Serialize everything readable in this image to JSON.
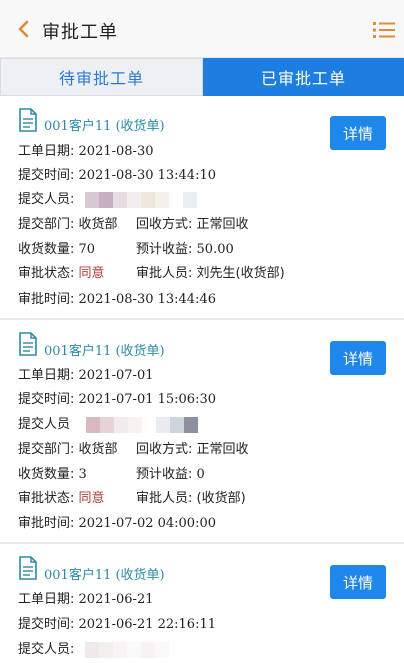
{
  "header": {
    "title": "审批工单",
    "colors": {
      "accent": "#e08a3c",
      "brand": "#1e7de0"
    }
  },
  "tabs": [
    {
      "label": "待审批工单",
      "active": false
    },
    {
      "label": "已审批工单",
      "active": true
    }
  ],
  "cards": [
    {
      "name": "001客户11 (收货单)",
      "detail_label": "详情",
      "date_label": "工单日期:",
      "date": "2021-08-30",
      "submit_time_label": "提交时间:",
      "submit_time": "2021-08-30 13:44:10",
      "submitter_label": "提交人员:",
      "dept_label": "提交部门:",
      "dept": "收货部",
      "method_label": "回收方式:",
      "method": "正常回收",
      "qty_label": "收货数量:",
      "qty": "70",
      "income_label": "预计收益:",
      "income": "50.00",
      "status_label": "审批状态:",
      "status": "同意",
      "approver_label": "审批人员:",
      "approver": "刘先生(收货部)",
      "approve_time_label": "审批时间:",
      "approve_time": "2021-08-30 13:44:46"
    },
    {
      "name": "001客户11 (收货单)",
      "detail_label": "详情",
      "date_label": "工单日期:",
      "date": "2021-07-01",
      "submit_time_label": "提交时间:",
      "submit_time": "2021-07-01 15:06:30",
      "submitter_label": "提交人员",
      "dept_label": "提交部门:",
      "dept": "收货部",
      "method_label": "回收方式:",
      "method": "正常回收",
      "qty_label": "收货数量:",
      "qty": "3",
      "income_label": "预计收益:",
      "income": "0",
      "status_label": "审批状态:",
      "status": "同意",
      "approver_label": "审批人员:",
      "approver": "(收货部)",
      "approve_time_label": "审批时间:",
      "approve_time": "2021-07-02 04:00:00"
    },
    {
      "name": "001客户11 (收货单)",
      "detail_label": "详情",
      "date_label": "工单日期:",
      "date": "2021-06-21",
      "submit_time_label": "提交时间:",
      "submit_time": "2021-06-21 22:16:11",
      "submitter_label": "提交人员:"
    }
  ]
}
